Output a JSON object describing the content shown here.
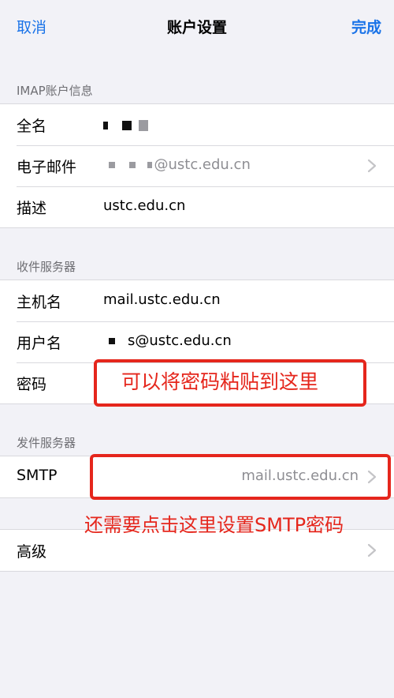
{
  "colors": {
    "accent": "#1a73e8",
    "secondary": "#6e6e73",
    "annotation": "#e5261c"
  },
  "nav": {
    "cancel": "取消",
    "title": "账户设置",
    "done": "完成"
  },
  "imap": {
    "header": "IMAP账户信息",
    "fullname_label": "全名",
    "email_label": "电子邮件",
    "email_value": "@ustc.edu.cn",
    "description_label": "描述",
    "description_value": "ustc.edu.cn"
  },
  "incoming": {
    "header": "收件服务器",
    "hostname_label": "主机名",
    "hostname_value": "mail.ustc.edu.cn",
    "username_label": "用户名",
    "username_value": "s@ustc.edu.cn",
    "password_label": "密码"
  },
  "outgoing": {
    "header": "发件服务器",
    "smtp_label": "SMTP",
    "smtp_value": "mail.ustc.edu.cn"
  },
  "advanced": {
    "label": "高级"
  },
  "annotations": {
    "password_hint": "可以将密码粘贴到这里",
    "smtp_hint": "还需要点击这里设置SMTP密码"
  },
  "icons": {
    "chevron": "chevron-right-icon"
  }
}
